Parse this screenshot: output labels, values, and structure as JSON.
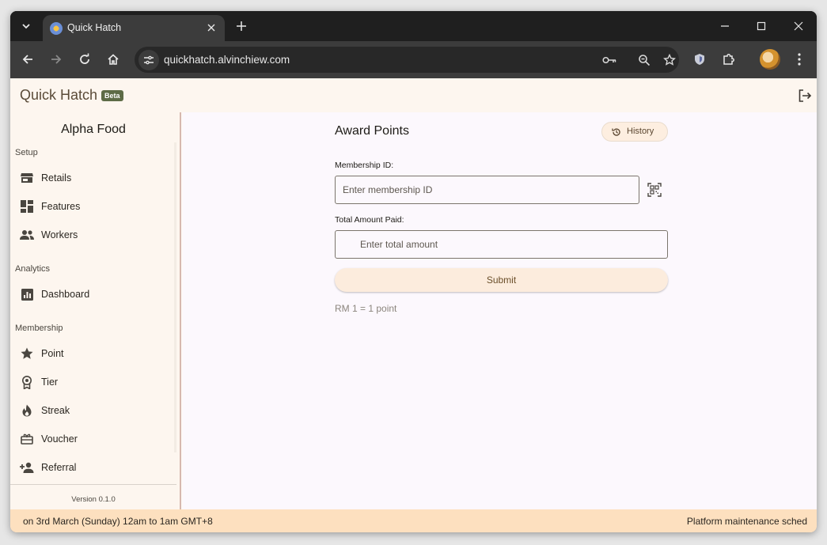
{
  "browser": {
    "tab_title": "Quick Hatch",
    "url": "quickhatch.alvinchiew.com"
  },
  "app": {
    "title": "Quick Hatch",
    "badge": "Beta"
  },
  "sidebar": {
    "org_name": "Alpha Food",
    "sections": [
      {
        "label": "Setup"
      },
      {
        "label": "Analytics"
      },
      {
        "label": "Membership"
      }
    ],
    "items": [
      {
        "label": "Retails",
        "icon": "store-icon"
      },
      {
        "label": "Features",
        "icon": "dashboard-grid-icon"
      },
      {
        "label": "Workers",
        "icon": "people-icon"
      },
      {
        "label": "Dashboard",
        "icon": "bar-chart-icon"
      },
      {
        "label": "Point",
        "icon": "star-icon"
      },
      {
        "label": "Tier",
        "icon": "award-ribbon-icon"
      },
      {
        "label": "Streak",
        "icon": "flame-icon"
      },
      {
        "label": "Voucher",
        "icon": "ticket-icon"
      },
      {
        "label": "Referral",
        "icon": "person-add-icon"
      }
    ],
    "version": "Version 0.1.0"
  },
  "main": {
    "title": "Award Points",
    "history_label": "History",
    "membership_label": "Membership ID:",
    "membership_placeholder": "Enter membership ID",
    "amount_label": "Total Amount Paid:",
    "amount_placeholder": "Enter total amount",
    "submit_label": "Submit",
    "rate_note": "RM 1 = 1 point"
  },
  "banner": {
    "left_text": "on 3rd March (Sunday) 12am to 1am GMT+8",
    "right_text": "Platform maintenance sched"
  },
  "colors": {
    "accent": "#5d6b46",
    "sidebar_border": "#d7b8ae",
    "banner_bg": "#fde0bf",
    "submit_bg": "#fcecdd"
  }
}
